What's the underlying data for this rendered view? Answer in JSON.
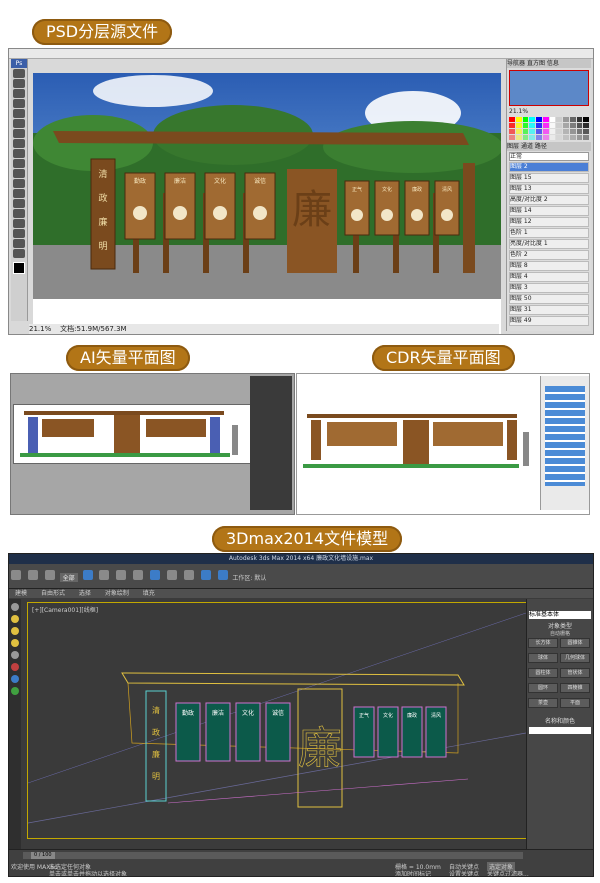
{
  "sections": {
    "psd": {
      "title": "PSD分层源文件"
    },
    "ai": {
      "title": "AI矢量平面图"
    },
    "cdr": {
      "title": "CDR矢量平面图"
    },
    "max": {
      "title": "3Dmax2014文件模型"
    }
  },
  "sign": {
    "left_column_chars": [
      "清",
      "政",
      "廉",
      "明"
    ],
    "panel_headings": [
      "勤政",
      "廉洁",
      "文化",
      "诚信"
    ],
    "panel_headings_right": [
      "正气",
      "文化",
      "廉政",
      "清风"
    ],
    "center_char": "廉"
  },
  "photoshop": {
    "app_icon": "Ps",
    "zoom": "21.1%",
    "doc_info": "文档:51.9M/567.3M",
    "nav_zoom": "21.1%",
    "panel_tabs": [
      "导航器",
      "直方图",
      "信息"
    ],
    "layers_tabs": [
      "图层",
      "通道",
      "路径"
    ],
    "blend_mode": "正常",
    "layers": [
      "图层 2",
      "图层 15",
      "图层 13",
      "高度/对比度 2",
      "图层 14",
      "图层 12",
      "色阶 1",
      "亮度/对比度 1",
      "色阶 2",
      "图层 8",
      "图层 4",
      "图层 3",
      "图层 50",
      "图层 31",
      "图层 49"
    ],
    "selected_layer_index": 0
  },
  "max": {
    "window_title": "Autodesk 3ds Max 2014 x64    廉政文化墙设施.max",
    "menu_hint": "键入关键字或短语",
    "workspace": "工作区: 默认",
    "select_filter": "全部",
    "ribbon_tabs": [
      "建模",
      "自由形式",
      "选择",
      "对象绘制",
      "填充"
    ],
    "viewport_label": "[+][Camera001][线框]",
    "cmd_section": "标准基本体",
    "object_type_label": "对象类型",
    "auto_grid": "自动栅格",
    "primitives": [
      "长方体",
      "圆锥体",
      "球体",
      "几何球体",
      "圆柱体",
      "管状体",
      "圆环",
      "四棱锥",
      "茶壶",
      "平面"
    ],
    "name_color_label": "名称和颜色",
    "frame_counter": "0 / 100",
    "status_selected": "未选定任何对象",
    "status_hint": "单击或单击并拖动以选择对象",
    "grid_value": "栅格 = 10.0mm",
    "auto_key": "自动关键点",
    "set_key": "设置关键点",
    "selected_obj": "选定对象",
    "key_filter": "关键点过滤器...",
    "welcome": "欢迎使用 MAXSc",
    "add_tag": "添加时间标记"
  },
  "colors": {
    "accent": "#b27517",
    "wood": "#7a4a1e",
    "sky": "#3a6fc0",
    "max_bg": "#3a3a3a"
  }
}
